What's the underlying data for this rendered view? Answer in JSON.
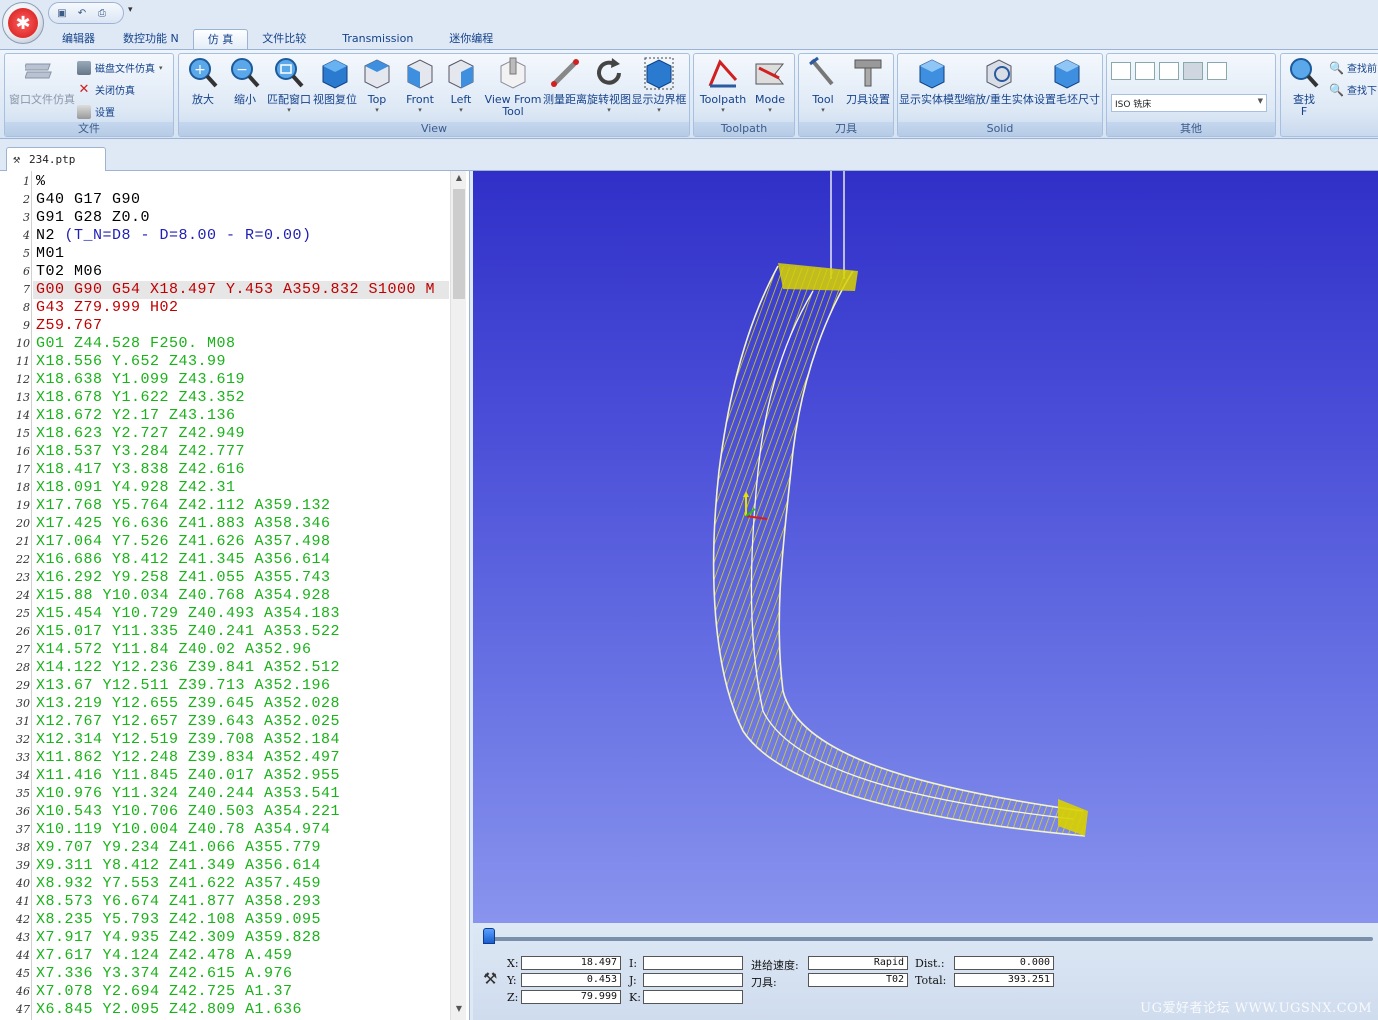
{
  "window": {
    "app_logo": "app-orb"
  },
  "quick_access": {
    "icons": [
      "save-icon",
      "undo-icon",
      "print-icon"
    ]
  },
  "tabs": [
    {
      "label": "编辑器"
    },
    {
      "label": "数控功能 N"
    },
    {
      "label": "仿 真"
    },
    {
      "label": "文件比较"
    },
    {
      "label": "Transmission"
    },
    {
      "label": "迷你编程"
    }
  ],
  "active_tab": "仿 真",
  "ribbon": {
    "file_group": {
      "label": "文件",
      "window_sim": "窗口文件仿真",
      "disk_sim": "磁盘文件仿真",
      "close_sim": "关闭仿真",
      "settings": "设置"
    },
    "view_group": {
      "label": "View",
      "buttons": [
        "放大",
        "缩小",
        "匹配窗口",
        "视图复位",
        "Top",
        "Front",
        "Left",
        "View From Tool",
        "测量距离",
        "旋转视图",
        "显示边界框"
      ]
    },
    "toolpath_group": {
      "label": "Toolpath",
      "buttons": [
        "Toolpath",
        "Mode"
      ]
    },
    "tool_group": {
      "label": "刀具",
      "buttons": [
        "Tool",
        "刀具设置"
      ]
    },
    "solid_group": {
      "label": "Solid",
      "buttons": [
        "显示实体模型",
        "缩放/重生实体",
        "设置毛坯尺寸"
      ]
    },
    "other_group": {
      "label": "其他",
      "machine_select": "ISO 铣床"
    },
    "find_group": {
      "find": "查找",
      "find_key": "F",
      "find_prev": "查找前",
      "find_next": "查找下"
    }
  },
  "doc_tab": {
    "filename": "234.ptp"
  },
  "editor": {
    "lines": [
      {
        "n": "1",
        "t": "%",
        "c": "#000000"
      },
      {
        "n": "2",
        "t": "G40 G17 G90",
        "c": "#000000"
      },
      {
        "n": "3",
        "t": "G91 G28 Z0.0",
        "c": "#000000"
      },
      {
        "n": "4",
        "t": "N2 (T_N=D8 - D=8.00 - R=0.00)",
        "c": "#000000"
      },
      {
        "n": "5",
        "t": "M01",
        "c": "#000000"
      },
      {
        "n": "6",
        "t": "T02 M06",
        "c": "#000000"
      },
      {
        "n": "7",
        "t": "G00 G90 G54 X18.497 Y.453 A359.832 S1000 M",
        "c": "#c00000"
      },
      {
        "n": "8",
        "t": "G43 Z79.999 H02",
        "c": "#c00000"
      },
      {
        "n": "9",
        "t": "Z59.767",
        "c": "#c00000"
      },
      {
        "n": "10",
        "t": "G01 Z44.528 F250. M08",
        "c": "#19b319"
      },
      {
        "n": "11",
        "t": "X18.556 Y.652 Z43.99",
        "c": "#19b319"
      },
      {
        "n": "12",
        "t": "X18.638 Y1.099 Z43.619",
        "c": "#19b319"
      },
      {
        "n": "13",
        "t": "X18.678 Y1.622 Z43.352",
        "c": "#19b319"
      },
      {
        "n": "14",
        "t": "X18.672 Y2.17 Z43.136",
        "c": "#19b319"
      },
      {
        "n": "15",
        "t": "X18.623 Y2.727 Z42.949",
        "c": "#19b319"
      },
      {
        "n": "16",
        "t": "X18.537 Y3.284 Z42.777",
        "c": "#19b319"
      },
      {
        "n": "17",
        "t": "X18.417 Y3.838 Z42.616",
        "c": "#19b319"
      },
      {
        "n": "18",
        "t": "X18.091 Y4.928 Z42.31",
        "c": "#19b319"
      },
      {
        "n": "19",
        "t": "X17.768 Y5.764 Z42.112 A359.132",
        "c": "#19b319"
      },
      {
        "n": "20",
        "t": "X17.425 Y6.636 Z41.883 A358.346",
        "c": "#19b319"
      },
      {
        "n": "21",
        "t": "X17.064 Y7.526 Z41.626 A357.498",
        "c": "#19b319"
      },
      {
        "n": "22",
        "t": "X16.686 Y8.412 Z41.345 A356.614",
        "c": "#19b319"
      },
      {
        "n": "23",
        "t": "X16.292 Y9.258 Z41.055 A355.743",
        "c": "#19b319"
      },
      {
        "n": "24",
        "t": "X15.88 Y10.034 Z40.768 A354.928",
        "c": "#19b319"
      },
      {
        "n": "25",
        "t": "X15.454 Y10.729 Z40.493 A354.183",
        "c": "#19b319"
      },
      {
        "n": "26",
        "t": "X15.017 Y11.335 Z40.241 A353.522",
        "c": "#19b319"
      },
      {
        "n": "27",
        "t": "X14.572 Y11.84 Z40.02 A352.96",
        "c": "#19b319"
      },
      {
        "n": "28",
        "t": "X14.122 Y12.236 Z39.841 A352.512",
        "c": "#19b319"
      },
      {
        "n": "29",
        "t": "X13.67 Y12.511 Z39.713 A352.196",
        "c": "#19b319"
      },
      {
        "n": "30",
        "t": "X13.219 Y12.655 Z39.645 A352.028",
        "c": "#19b319"
      },
      {
        "n": "31",
        "t": "X12.767 Y12.657 Z39.643 A352.025",
        "c": "#19b319"
      },
      {
        "n": "32",
        "t": "X12.314 Y12.519 Z39.708 A352.184",
        "c": "#19b319"
      },
      {
        "n": "33",
        "t": "X11.862 Y12.248 Z39.834 A352.497",
        "c": "#19b319"
      },
      {
        "n": "34",
        "t": "X11.416 Y11.845 Z40.017 A352.955",
        "c": "#19b319"
      },
      {
        "n": "35",
        "t": "X10.976 Y11.324 Z40.244 A353.541",
        "c": "#19b319"
      },
      {
        "n": "36",
        "t": "X10.543 Y10.706 Z40.503 A354.221",
        "c": "#19b319"
      },
      {
        "n": "37",
        "t": "X10.119 Y10.004 Z40.78 A354.974",
        "c": "#19b319"
      },
      {
        "n": "38",
        "t": "X9.707 Y9.234 Z41.066 A355.779",
        "c": "#19b319"
      },
      {
        "n": "39",
        "t": "X9.311 Y8.412 Z41.349 A356.614",
        "c": "#19b319"
      },
      {
        "n": "40",
        "t": "X8.932 Y7.553 Z41.622 A357.459",
        "c": "#19b319"
      },
      {
        "n": "41",
        "t": "X8.573 Y6.674 Z41.877 A358.293",
        "c": "#19b319"
      },
      {
        "n": "42",
        "t": "X8.235 Y5.793 Z42.108 A359.095",
        "c": "#19b319"
      },
      {
        "n": "43",
        "t": "X7.917 Y4.935 Z42.309 A359.828",
        "c": "#19b319"
      },
      {
        "n": "44",
        "t": "X7.617 Y4.124 Z42.478 A.459",
        "c": "#19b319"
      },
      {
        "n": "45",
        "t": "X7.336 Y3.374 Z42.615 A.976",
        "c": "#19b319"
      },
      {
        "n": "46",
        "t": "X7.078 Y2.694 Z42.725 A1.37",
        "c": "#19b319"
      },
      {
        "n": "47",
        "t": "X6.845 Y2.095 Z42.809 A1.636",
        "c": "#19b319"
      }
    ],
    "highlighted_line": 7,
    "comment_color": "#1f1fb4"
  },
  "status": {
    "x_label": "X:",
    "x_value": "18.497",
    "y_label": "Y:",
    "y_value": "0.453",
    "z_label": "Z:",
    "z_value": "79.999",
    "i_label": "I:",
    "i_value": "",
    "j_label": "J:",
    "j_value": "",
    "k_label": "K:",
    "k_value": "",
    "feed_label": "进给速度:",
    "feed_value": "Rapid",
    "tool_label": "刀具:",
    "tool_value": "T02",
    "dist_label": "Dist.:",
    "dist_value": "0.000",
    "total_label": "Total:",
    "total_value": "393.251",
    "progress": 0.0
  },
  "watermark": "UG爱好者论坛 WWW.UGSNX.COM",
  "colors": {
    "viewport_top": "#3030c8",
    "viewport_bottom": "#8994ee",
    "toolpath": "#e6e000",
    "rapid": "#c00000",
    "feed": "#19b319"
  }
}
